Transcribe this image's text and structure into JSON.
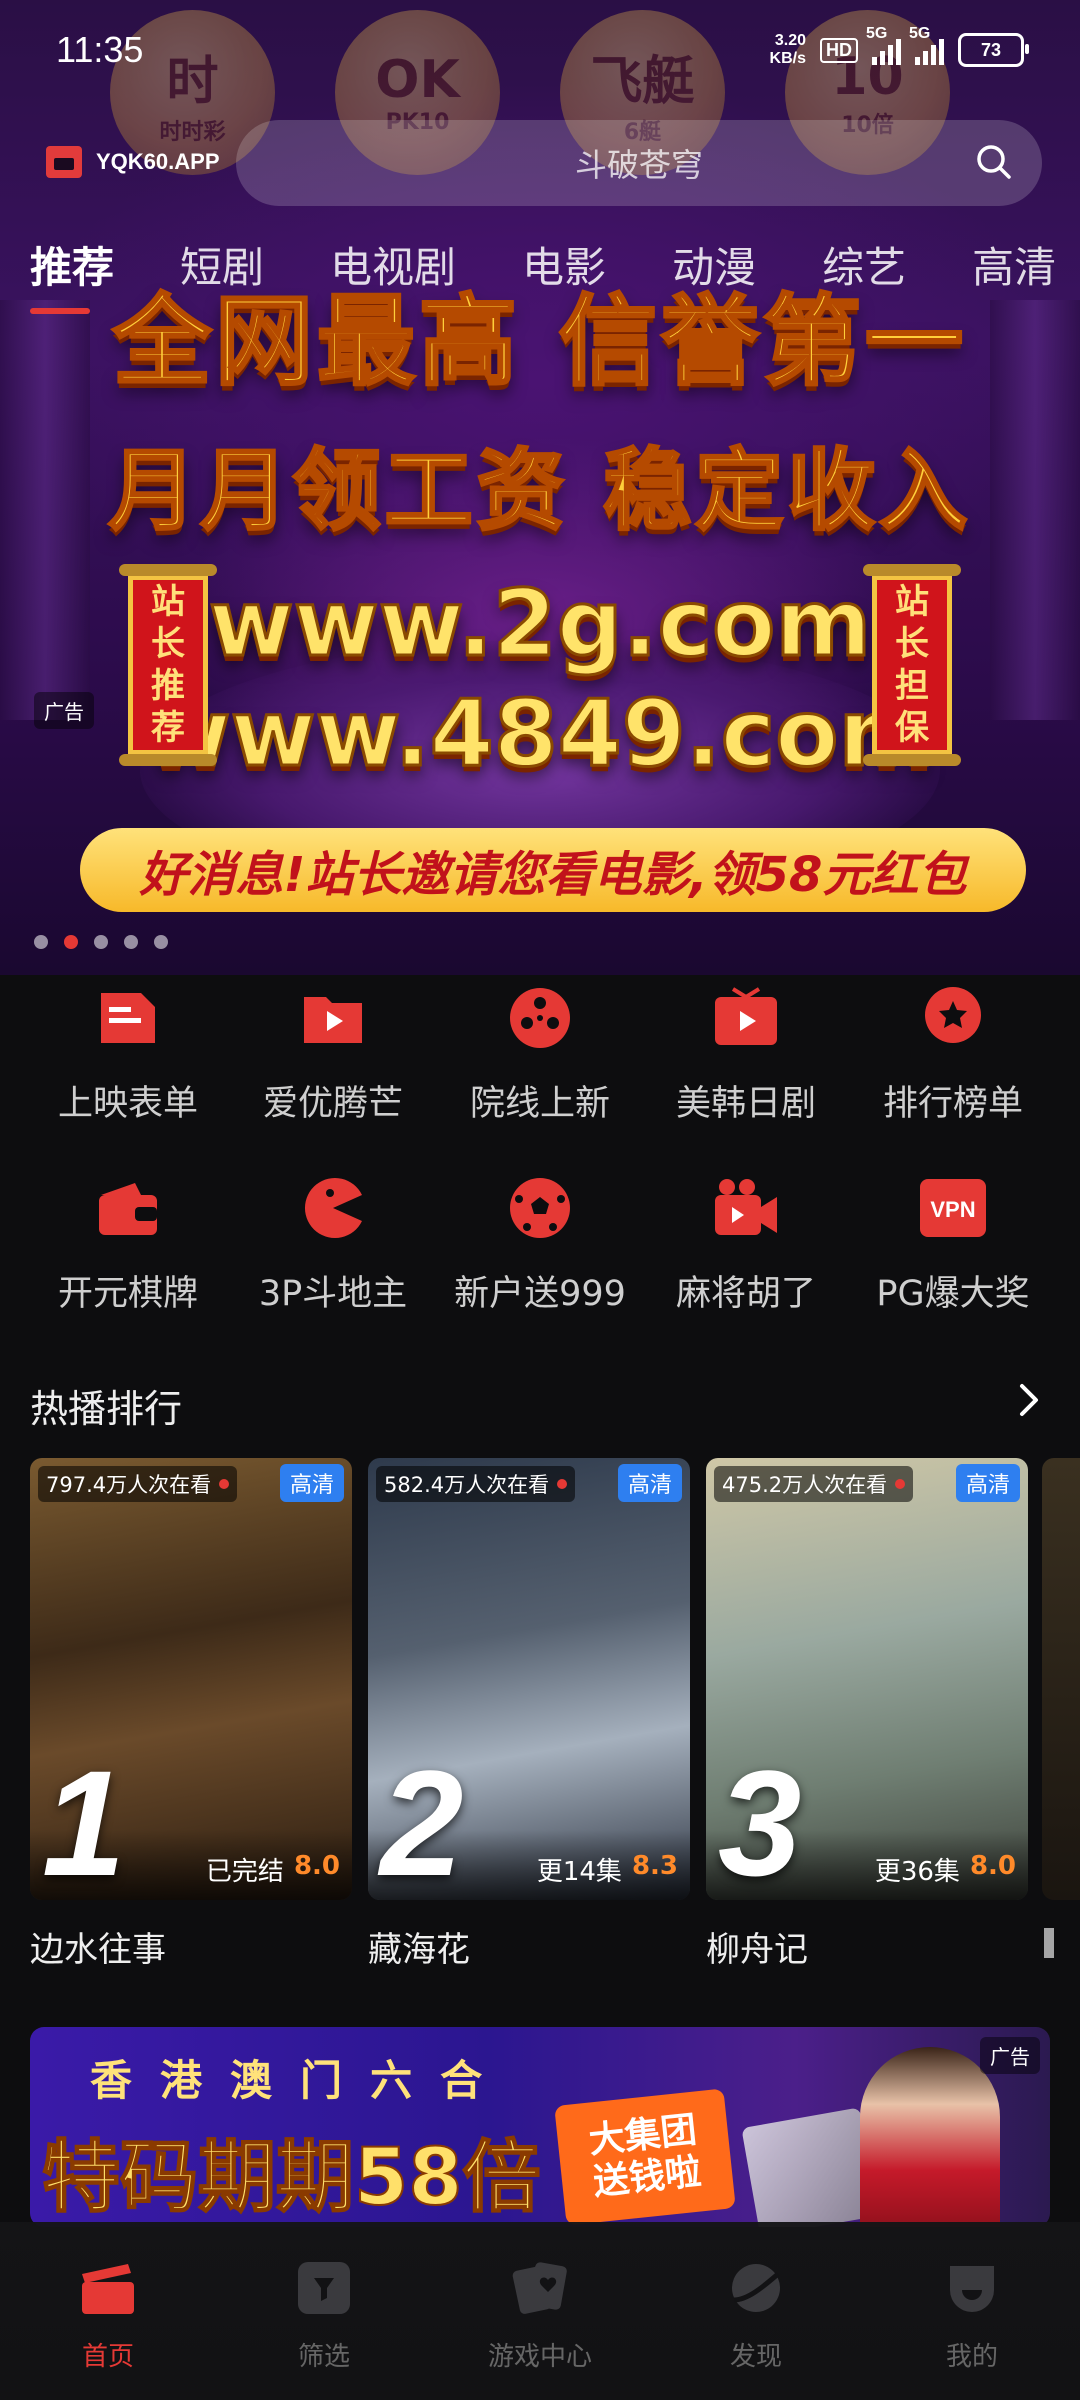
{
  "status_bar": {
    "time": "11:35",
    "net_speed_value": "3.20",
    "net_speed_unit": "KB/s",
    "hd": "HD",
    "sim1": "5G",
    "sim2": "5G",
    "battery": "73"
  },
  "header": {
    "logo_text": "YQK60.APP",
    "search_placeholder": "斗破苍穹"
  },
  "lottery_balls": [
    {
      "big": "时",
      "small": "时时彩"
    },
    {
      "big": "OK",
      "small": "PK10"
    },
    {
      "big": "飞艇",
      "small": "6艇"
    },
    {
      "big": "10",
      "small": "10倍"
    }
  ],
  "tabs": [
    "推荐",
    "短剧",
    "电视剧",
    "电影",
    "动漫",
    "综艺",
    "高清"
  ],
  "active_tab": "推荐",
  "hero_ad": {
    "headline1": "全网最高 信誉第一",
    "headline2": "月月领工资 稳定收入",
    "url1": "www.2g.com",
    "url2": "www.4849.com",
    "scroll_left": "站长推荐",
    "scroll_right": "站长担保",
    "promo": "好消息!站长邀请您看电影,领58元红包",
    "ad_tag": "广告",
    "slide_count": 5,
    "active_slide": 2
  },
  "quick_grid": [
    {
      "label": "上映表单",
      "icon": "schedule-icon"
    },
    {
      "label": "爱优腾芒",
      "icon": "play-folder-icon"
    },
    {
      "label": "院线上新",
      "icon": "film-reel-icon"
    },
    {
      "label": "美韩日剧",
      "icon": "tv-play-icon"
    },
    {
      "label": "排行榜单",
      "icon": "ranking-star-icon"
    },
    {
      "label": "开元棋牌",
      "icon": "wallet-icon"
    },
    {
      "label": "3P斗地主",
      "icon": "pacman-icon"
    },
    {
      "label": "新户送999",
      "icon": "soccer-ball-icon"
    },
    {
      "label": "麻将胡了",
      "icon": "video-camera-icon"
    },
    {
      "label": "PG爆大奖",
      "icon": "vpn-icon",
      "icon_text": "VPN"
    }
  ],
  "hot_section": {
    "title": "热播排行",
    "items": [
      {
        "rank": "1",
        "viewers": "797.4万人次在看",
        "badge": "高清",
        "status": "已完结",
        "score": "8.0",
        "title": "边水往事"
      },
      {
        "rank": "2",
        "viewers": "582.4万人次在看",
        "badge": "高清",
        "status": "更14集",
        "score": "8.3",
        "title": "藏海花"
      },
      {
        "rank": "3",
        "viewers": "475.2万人次在看",
        "badge": "高清",
        "status": "更36集",
        "score": "8.0",
        "title": "柳舟记"
      }
    ]
  },
  "bottom_ad": {
    "band": [
      "香",
      "港",
      "澳",
      "门",
      "六",
      "合"
    ],
    "headline": "特码期期58倍",
    "badge_line1": "大集团",
    "badge_line2": "送钱啦",
    "ad_tag": "广告"
  },
  "bottom_nav": [
    {
      "label": "首页",
      "active": true
    },
    {
      "label": "筛选",
      "active": false
    },
    {
      "label": "游戏中心",
      "active": false
    },
    {
      "label": "发现",
      "active": false
    },
    {
      "label": "我的",
      "active": false
    }
  ],
  "colors": {
    "accent": "#e53935",
    "score": "#ff8a2a",
    "hd_badge": "#2e7ff0",
    "background": "#0d0d0f"
  }
}
